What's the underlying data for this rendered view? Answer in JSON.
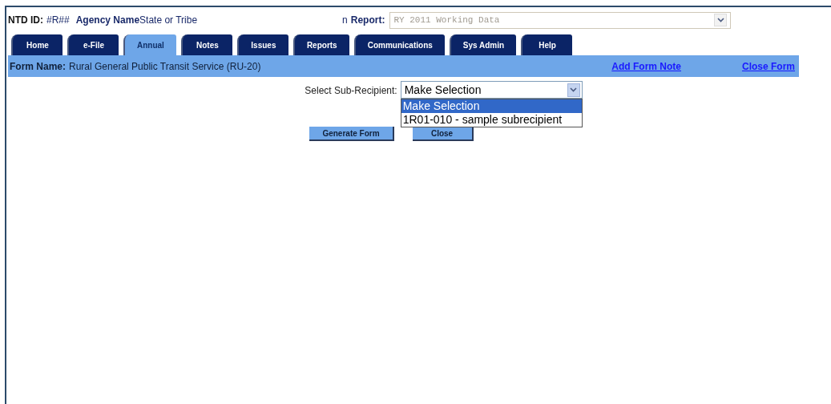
{
  "header": {
    "ntd_label": "NTD ID:",
    "ntd_value": "#R##",
    "agency_label": "Agency Name",
    "agency_value": "State or Tribe",
    "agency_tail": "n",
    "report_label": "Report:",
    "report_value": "RY 2011 Working Data"
  },
  "tabs": [
    {
      "label": "Home",
      "selected": false
    },
    {
      "label": "e-File",
      "selected": false
    },
    {
      "label": "Annual",
      "selected": true
    },
    {
      "label": "Notes",
      "selected": false
    },
    {
      "label": "Issues",
      "selected": false
    },
    {
      "label": "Reports",
      "selected": false
    },
    {
      "label": "Communications",
      "selected": false
    },
    {
      "label": "Sys Admin",
      "selected": false
    },
    {
      "label": "Help",
      "selected": false
    }
  ],
  "form_bar": {
    "label": "Form Name:",
    "value": "Rural General Public Transit Service (RU-20)",
    "links": [
      "Add Form Note",
      "Close Form"
    ]
  },
  "sub_recipient": {
    "label": "Select Sub-Recipient:",
    "value": "Make Selection",
    "expanded": true,
    "options": [
      {
        "label": "Make Selection",
        "selected": true
      },
      {
        "label": "1R01-010 - sample subrecipient",
        "selected": false
      }
    ]
  },
  "buttons": [
    "Generate Form",
    "Close"
  ]
}
